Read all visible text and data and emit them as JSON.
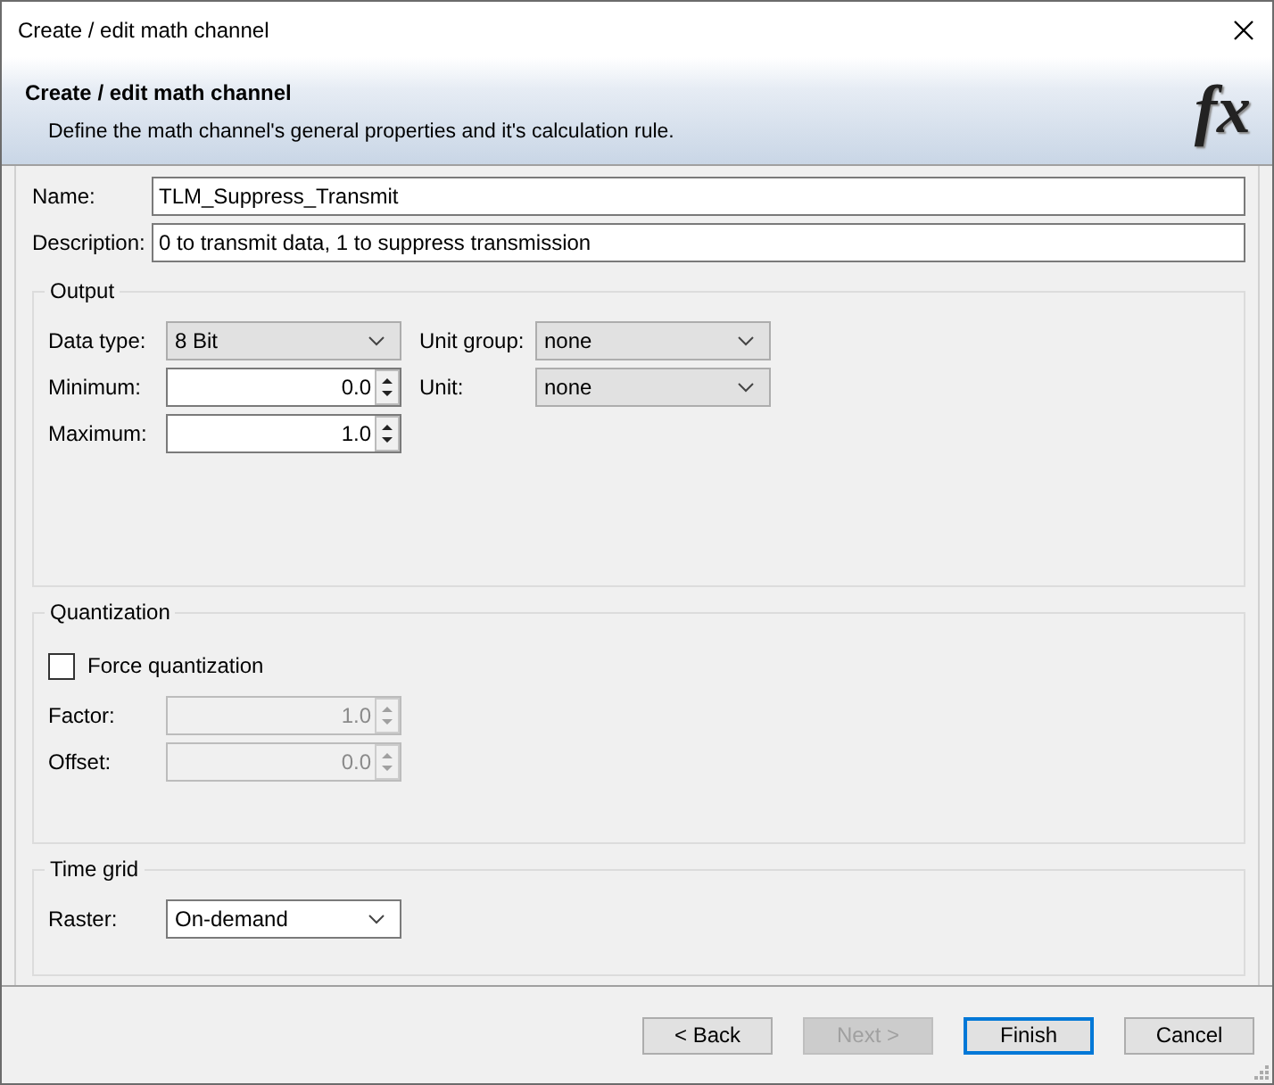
{
  "window": {
    "title": "Create / edit math channel"
  },
  "header": {
    "title": "Create / edit math channel",
    "subtitle": "Define the math channel's general properties and it's calculation rule.",
    "logo": "fx"
  },
  "fields": [
    {
      "label": "Name:",
      "value": "TLM_Suppress_Transmit"
    },
    {
      "label": "Description:",
      "value": "0 to transmit data, 1 to suppress transmission"
    }
  ],
  "output": {
    "title": "Output",
    "left": [
      {
        "kind": "combo",
        "label": "Data type:",
        "value": "8 Bit",
        "disabled": false
      },
      {
        "kind": "spinner",
        "label": "Minimum:",
        "value": "0.0",
        "disabled": false
      },
      {
        "kind": "spinner",
        "label": "Maximum:",
        "value": "1.0",
        "disabled": false
      }
    ],
    "right": [
      {
        "kind": "combo",
        "label": "Unit group:",
        "value": "none",
        "disabled": false
      },
      {
        "kind": "combo",
        "label": "Unit:",
        "value": "none",
        "disabled": false
      }
    ]
  },
  "quantization": {
    "title": "Quantization",
    "checkbox": {
      "label": "Force quantization",
      "checked": false
    },
    "rows": [
      {
        "kind": "spinner",
        "label": "Factor:",
        "value": "1.0",
        "disabled": true
      },
      {
        "kind": "spinner",
        "label": "Offset:",
        "value": "0.0",
        "disabled": true
      }
    ]
  },
  "time_grid": {
    "title": "Time grid",
    "rows": [
      {
        "kind": "dropdown",
        "label": "Raster:",
        "value": "On-demand",
        "disabled": false
      }
    ]
  },
  "buttons": [
    {
      "label": "< Back",
      "disabled": false,
      "default": false
    },
    {
      "label": "Next >",
      "disabled": true,
      "default": false
    },
    {
      "label": "Finish",
      "disabled": false,
      "default": true
    },
    {
      "label": "Cancel",
      "disabled": false,
      "default": false
    }
  ]
}
